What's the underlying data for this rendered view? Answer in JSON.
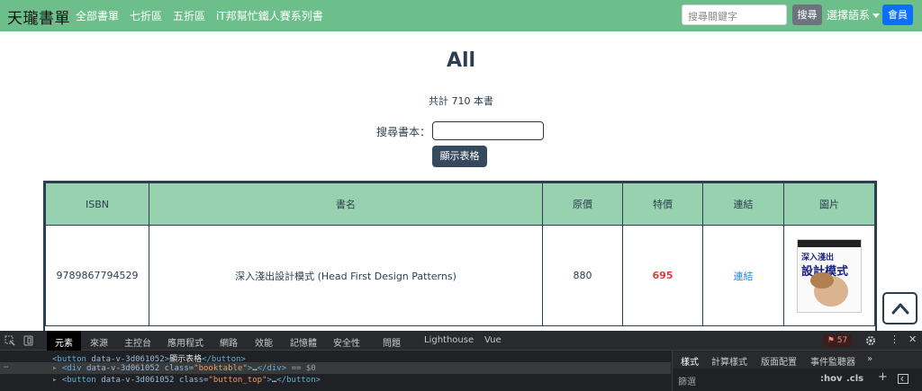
{
  "navbar": {
    "brand": "天瓏書單",
    "links": [
      "全部書單",
      "七折區",
      "五折區",
      "iT邦幫忙鐵人賽系列書"
    ],
    "search_placeholder": "搜尋關鍵字",
    "search_button": "搜尋",
    "language": "選擇語系",
    "member_button": "會員"
  },
  "main": {
    "title": "All",
    "count_text": "共計 710 本書",
    "search_label": "搜尋書本：",
    "show_table_button": "顯示表格"
  },
  "table": {
    "headers": [
      "ISBN",
      "書名",
      "原價",
      "特價",
      "連結",
      "圖片"
    ],
    "rows": [
      {
        "isbn": "9789867794529",
        "title": "深入淺出設計模式 (Head First Design Patterns)",
        "price": "880",
        "special_price": "695",
        "link": "連結",
        "cover_title": "深入淺出",
        "cover_subtitle": "設計模式"
      }
    ]
  },
  "devtools": {
    "tabs": [
      "元素",
      "來源",
      "主控台",
      "應用程式",
      "網路",
      "效能",
      "記憶體",
      "安全性",
      "問題",
      "Lighthouse",
      "Vue"
    ],
    "active_tab": "元素",
    "issue_count": "57",
    "code_lines": [
      {
        "open": "<button",
        "attr": "data-v-3d061052",
        "close": ">",
        "text": "顯示表格",
        "end": "</button>"
      },
      {
        "open": "<div",
        "attr": "data-v-3d061052",
        "class_val": "\"booktable\"",
        "text": "…",
        "end": "</div>",
        "suffix": "== $0"
      },
      {
        "open": "<button",
        "attr": "data-v-3d061052",
        "class_val": "\"button_top\"",
        "text": "…",
        "end": "</button>"
      }
    ],
    "right_tabs": [
      "樣式",
      "計算樣式",
      "版面配置",
      "事件監聽器"
    ],
    "filter_label": "篩選",
    "hov": ":hov",
    "cls": ".cls",
    "colors": {
      "bg": "#202124",
      "tag": "#5db0d7",
      "value": "#f29766"
    }
  }
}
